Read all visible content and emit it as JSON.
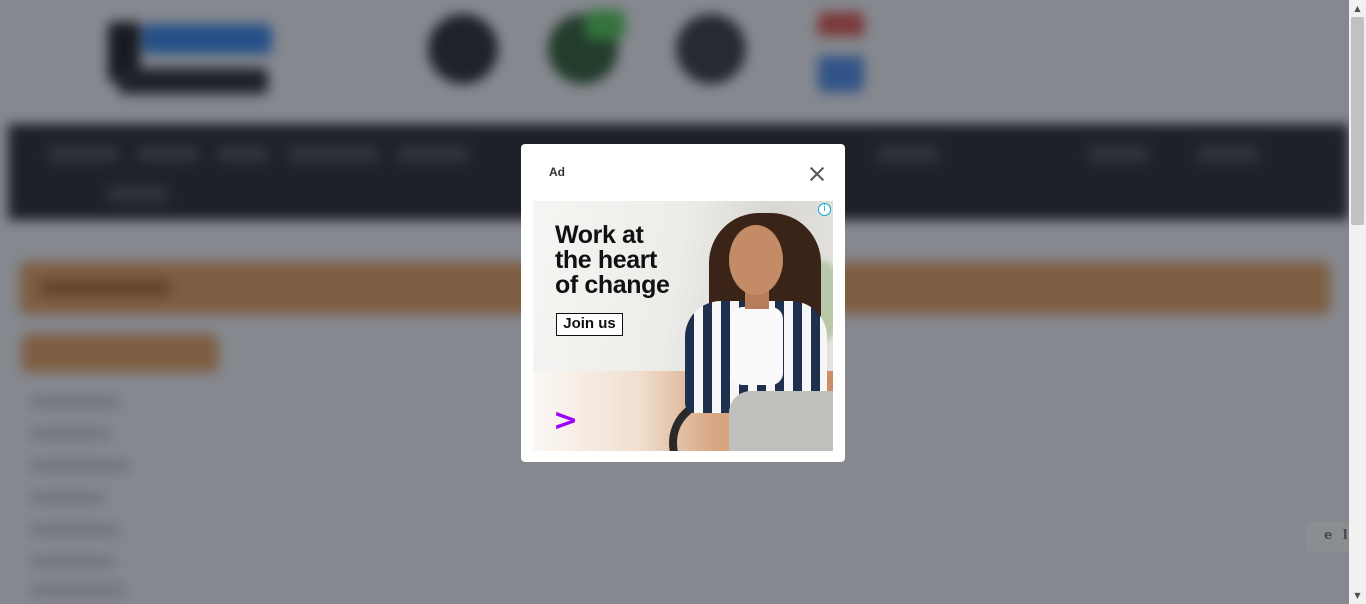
{
  "background": {
    "feedback_tab_text": "e l o"
  },
  "modal": {
    "ad_label": "Ad",
    "close_icon": "close-icon",
    "creative": {
      "headline": [
        "Work at",
        "the heart",
        "of change"
      ],
      "cta_label": "Join us",
      "brand_mark": ">",
      "brand_mark_color": "#a100ff",
      "info_icon": "info-icon",
      "info_glyph": "i",
      "info_color": "#00aecd"
    }
  },
  "scrollbar": {
    "up_glyph": "▲",
    "down_glyph": "▼"
  },
  "colors": {
    "overlay": "rgba(30, 36, 46, 0.54)",
    "accent_orange": "#f0a35a",
    "navbar": "#202020"
  }
}
